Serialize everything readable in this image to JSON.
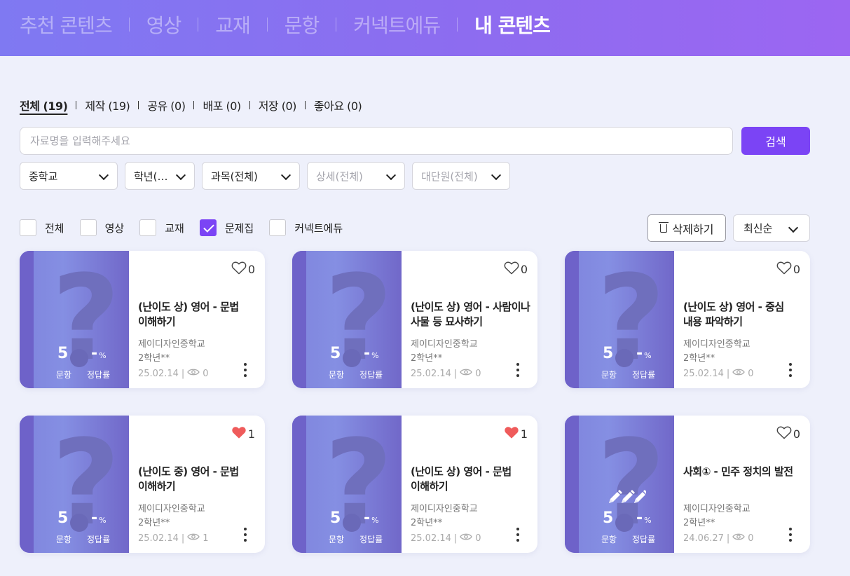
{
  "top_nav": {
    "tabs": [
      {
        "label": "추천 콘텐츠",
        "active": false
      },
      {
        "label": "영상",
        "active": false
      },
      {
        "label": "교재",
        "active": false
      },
      {
        "label": "문항",
        "active": false
      },
      {
        "label": "커넥트에듀",
        "active": false
      },
      {
        "label": "내 콘텐츠",
        "active": true
      }
    ]
  },
  "filters": {
    "items": [
      "전체 (19)",
      "제작 (19)",
      "공유 (0)",
      "배포 (0)",
      "저장 (0)",
      "좋아요 (0)"
    ],
    "active_index": 0
  },
  "search": {
    "placeholder": "자료명을 입력해주세요",
    "value": "",
    "button_label": "검색"
  },
  "dropdowns": [
    {
      "label": "중학교",
      "disabled": false
    },
    {
      "label": "학년(…",
      "disabled": false
    },
    {
      "label": "과목(전체)",
      "disabled": false
    },
    {
      "label": "상세(전체)",
      "disabled": true
    },
    {
      "label": "대단원(전체)",
      "disabled": true
    }
  ],
  "type_checkboxes": [
    {
      "label": "전체",
      "checked": false
    },
    {
      "label": "영상",
      "checked": false
    },
    {
      "label": "교재",
      "checked": false
    },
    {
      "label": "문제집",
      "checked": true
    },
    {
      "label": "커넥트에듀",
      "checked": false
    }
  ],
  "toolbar": {
    "delete_label": "삭제하기",
    "sort_label": "최신순"
  },
  "stat_labels": {
    "questions": "문항",
    "accuracy": "정답률"
  },
  "colors": {
    "accent": "#7b44f5",
    "heart": "#ef5b5b"
  },
  "cards": [
    {
      "title": "(난이도 상) 영어 - 문법 이해하기",
      "school": "제이디자인중학교",
      "grade": "2학년**",
      "date": "25.02.14",
      "views": "0",
      "likes": "0",
      "liked": false,
      "questions": "5",
      "rate": "-",
      "rate_unit": "%",
      "icon": "question-mark-icon"
    },
    {
      "title": "(난이도 상) 영어 - 사람이나 사물 등 묘사하기",
      "school": "제이디자인중학교",
      "grade": "2학년**",
      "date": "25.02.14",
      "views": "0",
      "likes": "0",
      "liked": false,
      "questions": "5",
      "rate": "-",
      "rate_unit": "%",
      "icon": "question-mark-icon"
    },
    {
      "title": "(난이도 상) 영어 - 중심 내용 파악하기",
      "school": "제이디자인중학교",
      "grade": "2학년**",
      "date": "25.02.14",
      "views": "0",
      "likes": "0",
      "liked": false,
      "questions": "5",
      "rate": "-",
      "rate_unit": "%",
      "icon": "question-mark-icon"
    },
    {
      "title": "(난이도 중) 영어 - 문법 이해하기",
      "school": "제이디자인중학교",
      "grade": "2학년**",
      "date": "25.02.14",
      "views": "1",
      "likes": "1",
      "liked": true,
      "questions": "5",
      "rate": "-",
      "rate_unit": "%",
      "icon": "question-mark-icon"
    },
    {
      "title": "(난이도 상) 영어 - 문법 이해하기",
      "school": "제이디자인중학교",
      "grade": "2학년**",
      "date": "25.02.14",
      "views": "0",
      "likes": "1",
      "liked": true,
      "questions": "5",
      "rate": "-",
      "rate_unit": "%",
      "icon": "question-mark-icon"
    },
    {
      "title": "사회① - 민주 정치의 발전",
      "school": "제이디자인중학교",
      "grade": "2학년**",
      "date": "24.06.27",
      "views": "0",
      "likes": "0",
      "liked": false,
      "questions": "5",
      "rate": "-",
      "rate_unit": "%",
      "icon": "question-mark-pencil-icon"
    }
  ]
}
